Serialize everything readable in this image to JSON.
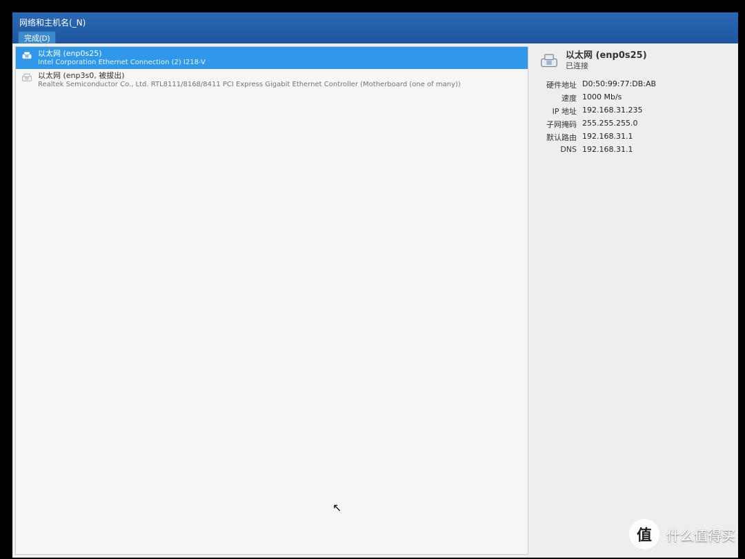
{
  "title": "网络和主机名(_N)",
  "done_label": "完成(D)",
  "interfaces": [
    {
      "name": "以太网 (enp0s25)",
      "desc": "Intel Corporation Ethernet Connection (2) I218-V",
      "selected": true
    },
    {
      "name": "以太网 (enp3s0, 被拔出)",
      "desc": "Realtek Semiconductor Co., Ltd. RTL8111/8168/8411 PCI Express Gigabit Ethernet Controller (Motherboard (one of many))",
      "selected": false
    }
  ],
  "detail": {
    "title": "以太网 (enp0s25)",
    "status": "已连接",
    "rows": [
      {
        "label": "硬件地址",
        "value": "D0:50:99:77:DB:AB"
      },
      {
        "label": "速度",
        "value": "1000 Mb/s"
      },
      {
        "label": "IP 地址",
        "value": "192.168.31.235"
      },
      {
        "label": "子网掩码",
        "value": "255.255.255.0"
      },
      {
        "label": "默认路由",
        "value": "192.168.31.1"
      },
      {
        "label": "DNS",
        "value": "192.168.31.1"
      }
    ]
  },
  "watermark": "什么值得买"
}
